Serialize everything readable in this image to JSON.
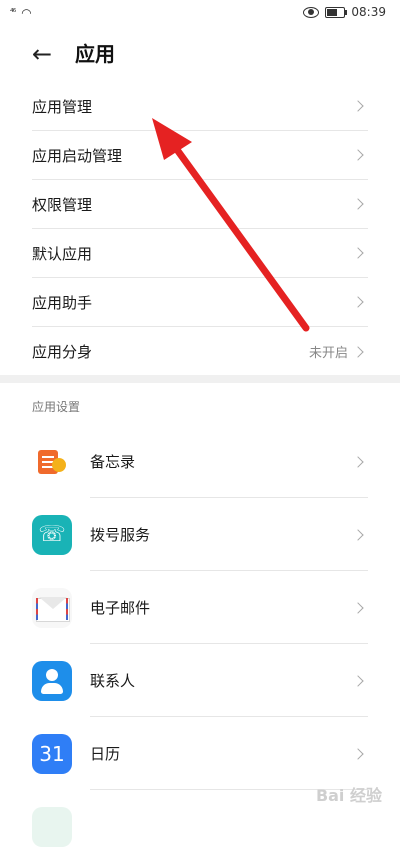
{
  "status": {
    "signal": "⁴⁶",
    "time": "08:39"
  },
  "header": {
    "back_label": "←",
    "title": "应用"
  },
  "menu": [
    {
      "label": "应用管理",
      "value": ""
    },
    {
      "label": "应用启动管理",
      "value": ""
    },
    {
      "label": "权限管理",
      "value": ""
    },
    {
      "label": "默认应用",
      "value": ""
    },
    {
      "label": "应用助手",
      "value": ""
    },
    {
      "label": "应用分身",
      "value": "未开启"
    }
  ],
  "section_title": "应用设置",
  "apps": [
    {
      "label": "备忘录",
      "icon": "memo-icon"
    },
    {
      "label": "拨号服务",
      "icon": "phone-icon"
    },
    {
      "label": "电子邮件",
      "icon": "mail-icon"
    },
    {
      "label": "联系人",
      "icon": "contacts-icon"
    },
    {
      "label": "日历",
      "icon": "calendar-icon",
      "icon_text": "31"
    }
  ],
  "watermark": "Bai 经验",
  "colors": {
    "arrow": "#e52222",
    "accent": "#1e8eea"
  }
}
